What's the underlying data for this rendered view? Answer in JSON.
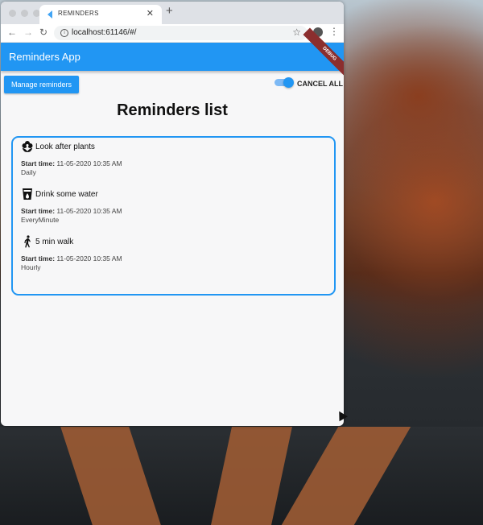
{
  "browser": {
    "tab_title": "REMINDERS",
    "url": "localhost:61146/#/"
  },
  "app": {
    "title": "Reminders App",
    "debug_banner": "DEBUG",
    "manage_button": "Manage reminders",
    "cancel_all": "CANCEL ALL",
    "cancel_all_toggle_on": true,
    "list_title": "Reminders list",
    "start_time_label": "Start time:"
  },
  "reminders": [
    {
      "name": "Look after plants",
      "icon": "flower-icon",
      "start_time": "11-05-2020 10:35 AM",
      "frequency": "Daily"
    },
    {
      "name": "Drink some water",
      "icon": "water-glass-icon",
      "start_time": "11-05-2020 10:35 AM",
      "frequency": "EveryMinute"
    },
    {
      "name": "5 min walk",
      "icon": "walking-person-icon",
      "start_time": "11-05-2020 10:35 AM",
      "frequency": "Hourly"
    }
  ],
  "colors": {
    "accent": "#2196f3",
    "debug": "#8b2e2e"
  }
}
